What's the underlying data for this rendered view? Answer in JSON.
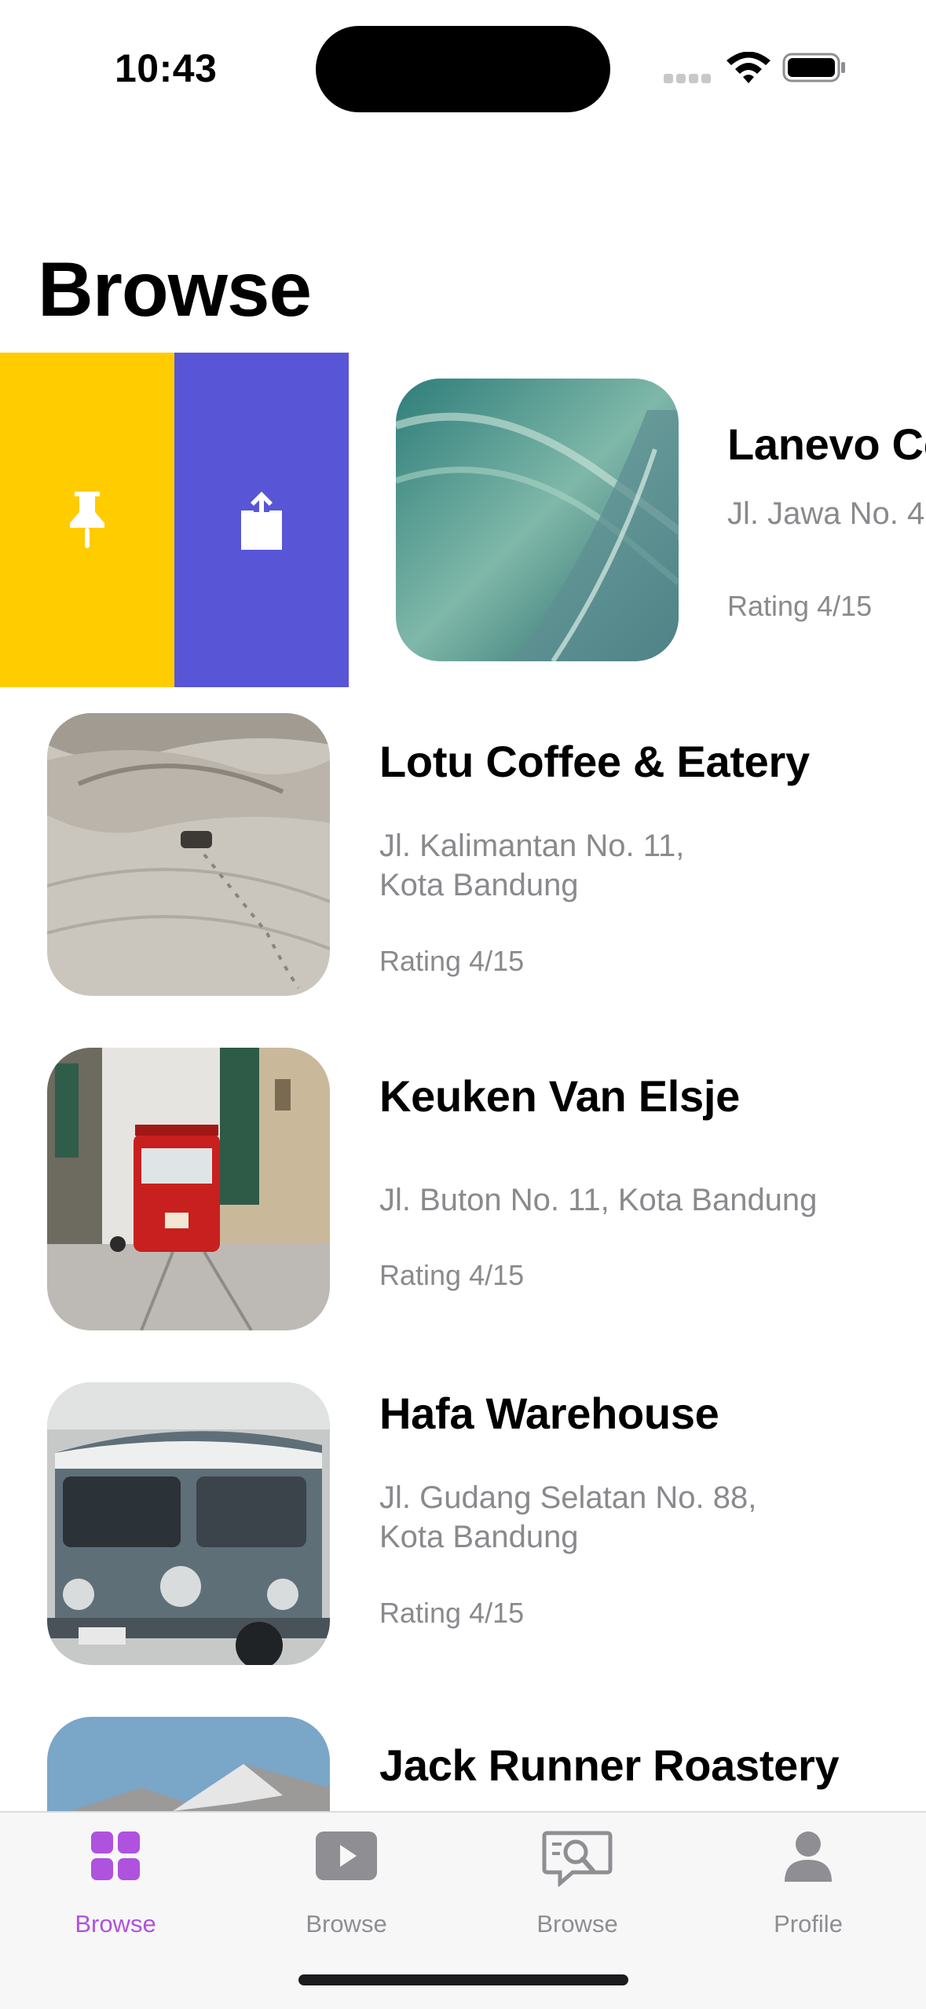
{
  "status": {
    "time": "10:43"
  },
  "header": {
    "title": "Browse"
  },
  "swipe_actions": {
    "pin_icon": "pin-icon",
    "share_icon": "share-icon",
    "pin_color": "#ffcc00",
    "share_color": "#5856d6"
  },
  "places": [
    {
      "name": "Lanevo Coffee",
      "address": "Jl. Jawa No. 4",
      "rating": "Rating 4/15",
      "image": "water-wave"
    },
    {
      "name": "Lotu Coffee & Eatery",
      "address": "Jl. Kalimantan No. 11,\nKota Bandung",
      "rating": "Rating 4/15",
      "image": "desert-dunes"
    },
    {
      "name": "Keuken Van Elsje",
      "address": "Jl. Buton No. 11, Kota Bandung",
      "rating": "Rating 4/15",
      "image": "red-tram-street"
    },
    {
      "name": "Hafa Warehouse",
      "address": "Jl. Gudang Selatan No. 88,\nKota Bandung",
      "rating": "Rating 4/15",
      "image": "vw-van"
    },
    {
      "name": "Jack Runner Roastery",
      "address": "",
      "rating": "",
      "image": "mountain"
    }
  ],
  "tabbar": {
    "tabs": [
      {
        "label": "Browse",
        "icon": "grid-icon",
        "active": true
      },
      {
        "label": "Browse",
        "icon": "play-icon",
        "active": false
      },
      {
        "label": "Browse",
        "icon": "chat-search-icon",
        "active": false
      },
      {
        "label": "Profile",
        "icon": "person-icon",
        "active": false
      }
    ],
    "active_color": "#af52de",
    "inactive_color": "#8e8e93"
  }
}
